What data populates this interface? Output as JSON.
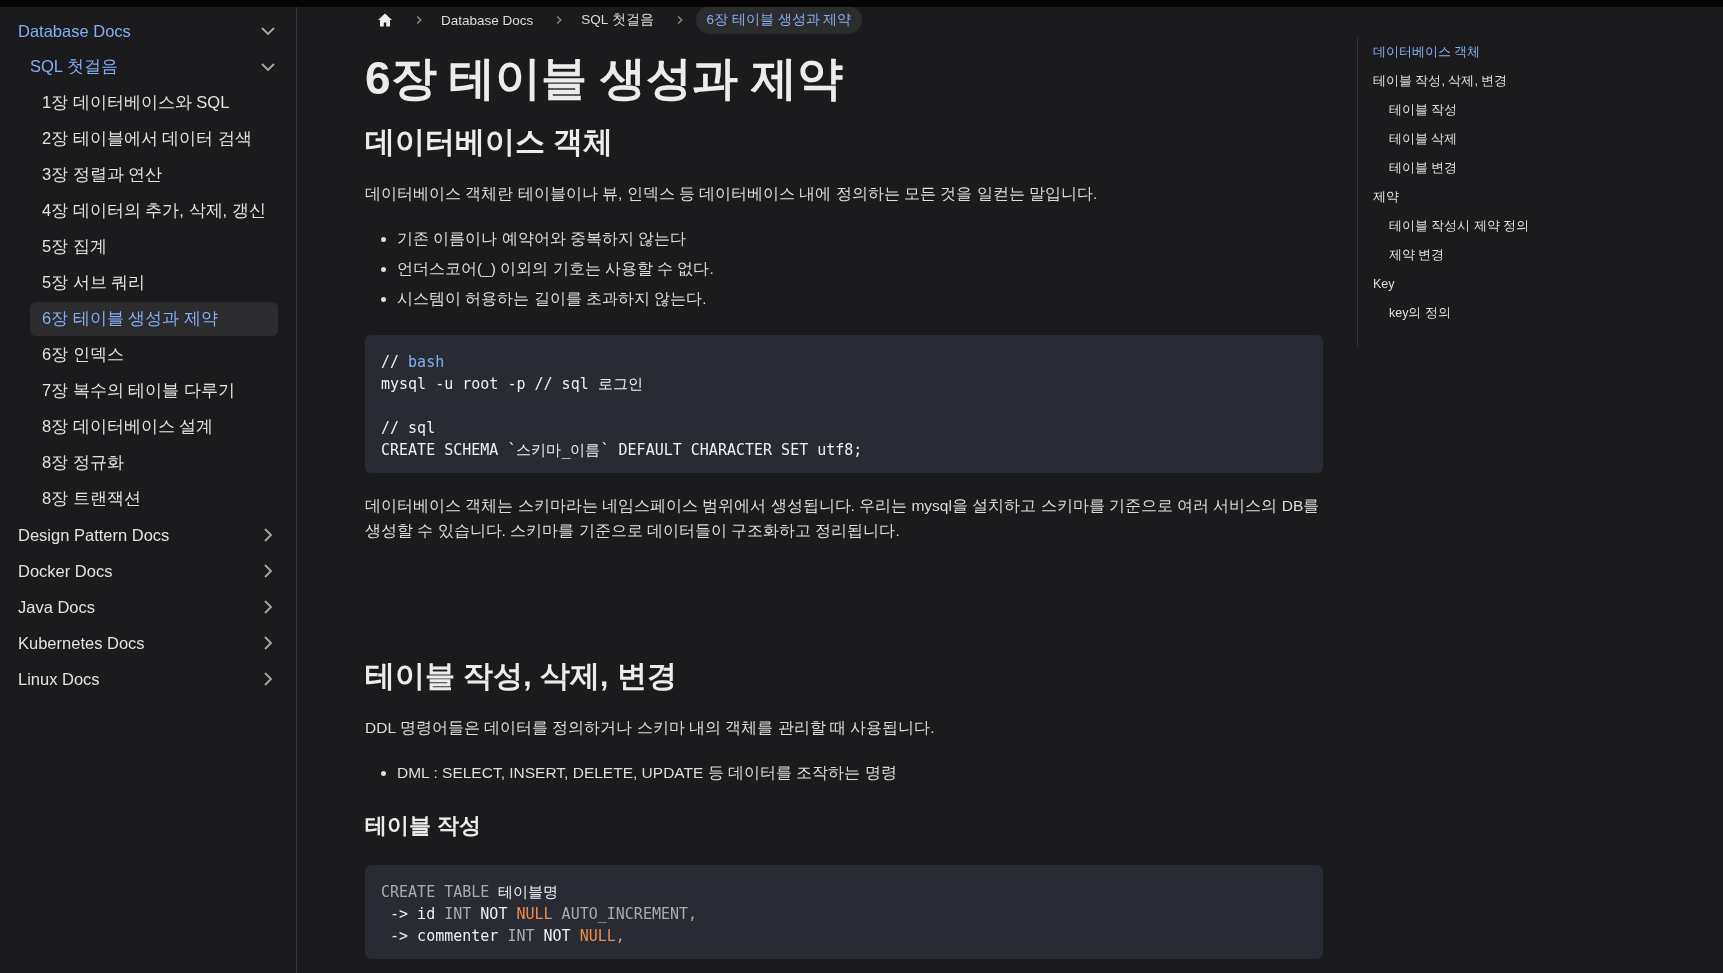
{
  "sidebar": {
    "items": [
      {
        "label": "Database Docs",
        "expanded": true,
        "selected": false,
        "children": [
          {
            "label": "SQL 첫걸음",
            "expanded": true,
            "selected": false,
            "children": [
              {
                "label": "1장 데이터베이스와 SQL",
                "selected": false
              },
              {
                "label": "2장 테이블에서 데이터 검색",
                "selected": false
              },
              {
                "label": "3장 정렬과 연산",
                "selected": false
              },
              {
                "label": "4장 데이터의 추가, 삭제, 갱신",
                "selected": false
              },
              {
                "label": "5장 집계",
                "selected": false
              },
              {
                "label": "5장 서브 쿼리",
                "selected": false
              },
              {
                "label": "6장 테이블 생성과 제약",
                "selected": true
              },
              {
                "label": "6장 인덱스",
                "selected": false
              },
              {
                "label": "7장 복수의 테이블 다루기",
                "selected": false
              },
              {
                "label": "8장 데이터베이스 설계",
                "selected": false
              },
              {
                "label": "8장 정규화",
                "selected": false
              },
              {
                "label": "8장 트랜잭션",
                "selected": false
              }
            ]
          }
        ]
      },
      {
        "label": "Design Pattern Docs",
        "expanded": false,
        "selected": false
      },
      {
        "label": "Docker Docs",
        "expanded": false,
        "selected": false
      },
      {
        "label": "Java Docs",
        "expanded": false,
        "selected": false
      },
      {
        "label": "Kubernetes Docs",
        "expanded": false,
        "selected": false
      },
      {
        "label": "Linux Docs",
        "expanded": false,
        "selected": false
      }
    ]
  },
  "breadcrumb": [
    {
      "label": "Database Docs",
      "selected": false
    },
    {
      "label": "SQL 첫걸음",
      "selected": false
    },
    {
      "label": "6장 테이블 생성과 제약",
      "selected": true
    }
  ],
  "content": [
    {
      "kind": "h1",
      "text": "6장 테이블 생성과 제약"
    },
    {
      "kind": "h2",
      "text": "데이터베이스 객체"
    },
    {
      "kind": "p",
      "text": "데이터베이스 객체란 테이블이나 뷰, 인덱스 등 데이터베이스 내에 정의하는 모든 것을 일컫는 말입니다."
    },
    {
      "kind": "ul",
      "items": [
        "기존 이름이나 예약어와 중복하지 않는다",
        "언더스코어(_) 이외의 기호는 사용할 수 없다.",
        "시스템이 허용하는 길이를 초과하지 않는다."
      ]
    },
    {
      "kind": "code",
      "groups": [
        [
          [
            {
              "text": "// ",
              "kind": "text"
            },
            {
              "text": "bash",
              "kind": "keyword"
            }
          ],
          [
            {
              "text": "mysql -u root -p // sql 로그인",
              "kind": "text"
            }
          ]
        ],
        [
          [
            {
              "text": "// sql",
              "kind": "text"
            }
          ],
          [
            {
              "text": "CREATE SCHEMA `스키마_이름` DEFAULT CHARACTER SET utf8;",
              "kind": "text"
            }
          ]
        ]
      ]
    },
    {
      "kind": "p",
      "text": "데이터베이스 객체는 스키마라는 네임스페이스 범위에서 생성됩니다. 우리는 mysql을 설치하고 스키마를 기준으로 여러 서비스의 DB를 생성할 수 있습니다. 스키마를 기준으로 데이터들이 구조화하고 정리됩니다."
    },
    {
      "kind": "h2",
      "text": "테이블 작성, 삭제, 변경"
    },
    {
      "kind": "p",
      "text": "DDL 명령어들은 데이터를 정의하거나 스키마 내의 객체를 관리할 때 사용됩니다."
    },
    {
      "kind": "ul",
      "items": [
        "DML : SELECT, INSERT, DELETE, UPDATE 등 데이터를 조작하는 명령"
      ]
    },
    {
      "kind": "h3",
      "text": "테이블 작성"
    },
    {
      "kind": "code",
      "groups": [
        [
          [
            {
              "text": "CREATE TABLE ",
              "kind": "muted"
            },
            {
              "text": "테이블명",
              "kind": "text"
            }
          ],
          [
            {
              "text": " -> id ",
              "kind": "text"
            },
            {
              "text": "INT ",
              "kind": "muted"
            },
            {
              "text": "NOT ",
              "kind": "text"
            },
            {
              "text": "NULL",
              "kind": "literal"
            },
            {
              "text": " AUTO_INCREMENT,",
              "kind": "muted"
            }
          ],
          [
            {
              "text": " -> commenter ",
              "kind": "text"
            },
            {
              "text": "INT ",
              "kind": "muted"
            },
            {
              "text": "NOT ",
              "kind": "text"
            },
            {
              "text": "NULL",
              "kind": "literal"
            },
            {
              "text": ",",
              "kind": "muted"
            }
          ]
        ]
      ]
    }
  ],
  "toc": [
    {
      "label": "데이터베이스 객체",
      "selected": true
    },
    {
      "label": "테이블 작성, 삭제, 변경",
      "selected": false,
      "children": [
        {
          "label": "테이블 작성",
          "selected": false
        },
        {
          "label": "테이블 삭제",
          "selected": false
        },
        {
          "label": "테이블 변경",
          "selected": false
        }
      ]
    },
    {
      "label": "제약",
      "selected": false,
      "children": [
        {
          "label": "테이블 작성시 제약 정의",
          "selected": false
        },
        {
          "label": "제약 변경",
          "selected": false
        }
      ]
    },
    {
      "label": "Key",
      "selected": false,
      "children": [
        {
          "label": "key의 정의",
          "selected": false
        }
      ]
    }
  ]
}
